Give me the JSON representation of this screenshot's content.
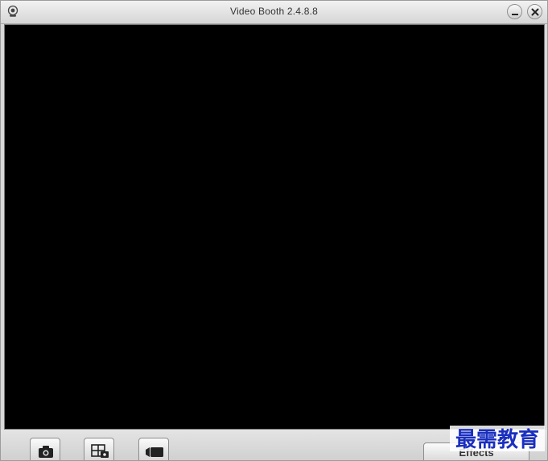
{
  "window": {
    "title": "Video Booth  2.4.8.8"
  },
  "titlebar": {
    "app_icon": "webcam-icon",
    "minimize_icon": "minimize-icon",
    "close_icon": "close-icon"
  },
  "viewport": {
    "background": "#000000"
  },
  "toolbar": {
    "buttons": [
      {
        "icon": "camera-icon",
        "mode": "photo"
      },
      {
        "icon": "burst-icon",
        "mode": "burst"
      },
      {
        "icon": "video-camera-icon",
        "mode": "video"
      }
    ],
    "effects_label": "Effects"
  },
  "watermark": {
    "text": "最需教育",
    "color": "#1a2fbf"
  }
}
